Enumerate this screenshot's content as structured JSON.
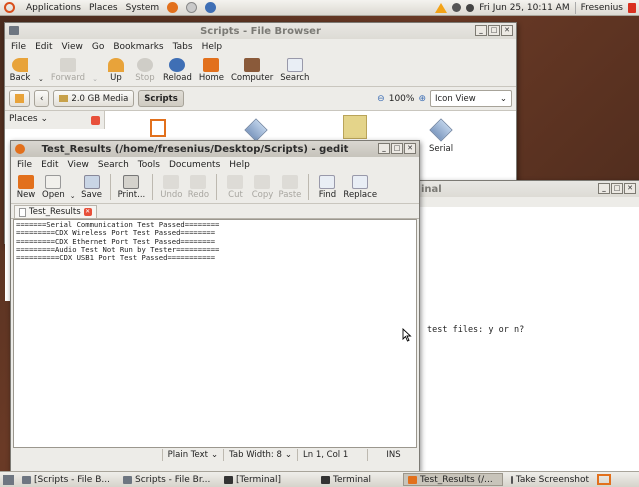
{
  "top_panel": {
    "menu": [
      "Applications",
      "Places",
      "System"
    ],
    "clock": "Fri Jun 25, 10:11 AM",
    "user": "Fresenius"
  },
  "file_browser": {
    "title": "Scripts - File Browser",
    "menu": [
      "File",
      "Edit",
      "View",
      "Go",
      "Bookmarks",
      "Tabs",
      "Help"
    ],
    "toolbar": {
      "back": "Back",
      "forward": "Forward",
      "up": "Up",
      "stop": "Stop",
      "reload": "Reload",
      "home": "Home",
      "computer": "Computer",
      "search": "Search"
    },
    "path": {
      "media": "2.0 GB Media",
      "current": "Scripts"
    },
    "zoom": "100%",
    "view_mode": "Icon View",
    "places_label": "Places",
    "files": [
      "Serial"
    ]
  },
  "terminal": {
    "title": "Terminal",
    "title_visible": "inal",
    "line": "test files: y or n?"
  },
  "gedit": {
    "title": "Test_Results (/home/fresenius/Desktop/Scripts) - gedit",
    "menu": [
      "File",
      "Edit",
      "View",
      "Search",
      "Tools",
      "Documents",
      "Help"
    ],
    "toolbar": {
      "new": "New",
      "open": "Open",
      "save": "Save",
      "print": "Print...",
      "undo": "Undo",
      "redo": "Redo",
      "cut": "Cut",
      "copy": "Copy",
      "paste": "Paste",
      "find": "Find",
      "replace": "Replace"
    },
    "tab_label": "Test_Results",
    "content": [
      "=======Serial Communication Test Passed========",
      "=========CDX Wireless Port Test Passed========",
      "=========CDX Ethernet Port Test Passed========",
      "=========Audio Test Not Run by Tester==========",
      "==========CDX USB1 Port Test Passed==========="
    ],
    "status": {
      "language": "Plain Text",
      "tab_width": "Tab Width: 8",
      "position": "Ln 1, Col 1",
      "mode": "INS"
    }
  },
  "taskbar": {
    "tasks": [
      "[Scripts - File B...",
      "Scripts - File Br...",
      "[Terminal]",
      "Terminal",
      "Test_Results (/...",
      "Take Screenshot"
    ]
  },
  "colors": {
    "desktop": "#4a2c1e",
    "accent_orange": "#e2701c",
    "close_red": "#e8503a"
  }
}
